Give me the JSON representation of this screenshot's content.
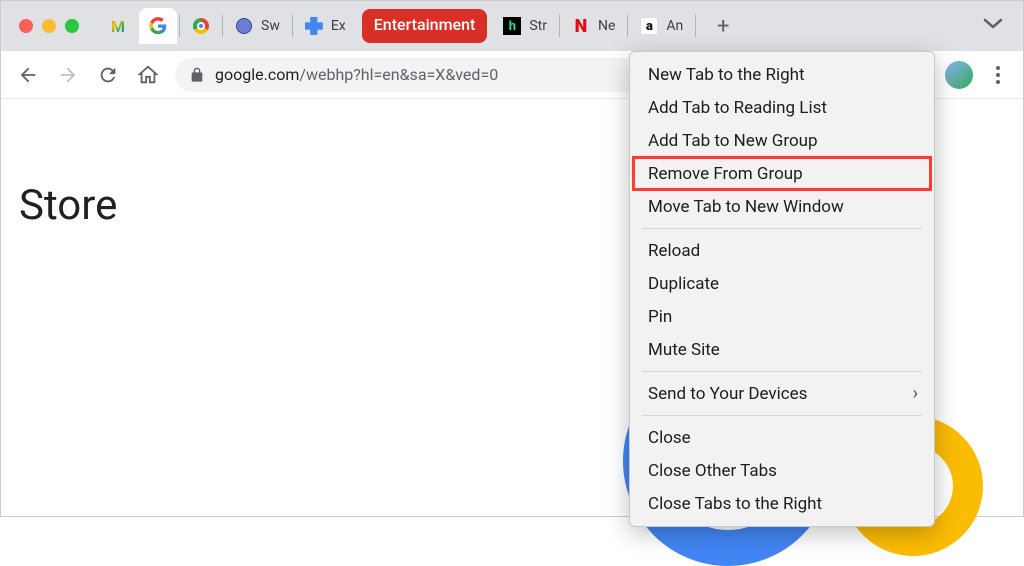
{
  "window_controls": [
    "close",
    "minimize",
    "maximize"
  ],
  "tabs": [
    {
      "favicon": "gmail",
      "label": ""
    },
    {
      "favicon": "google",
      "label": "",
      "active": true
    },
    {
      "favicon": "chrome",
      "label": ""
    },
    {
      "favicon": "globe",
      "label": "Sw"
    },
    {
      "favicon": "ext",
      "label": "Ex"
    }
  ],
  "tab_group": {
    "label": "Entertainment",
    "color": "#d93025"
  },
  "group_tabs": [
    {
      "favicon": "hulu",
      "label": "Str"
    },
    {
      "favicon": "netflix",
      "label": "Ne"
    },
    {
      "favicon": "amazon",
      "label": "An"
    }
  ],
  "url": {
    "host": "google.com",
    "path": "/webhp?hl=en&sa=X&ved=0"
  },
  "page": {
    "store_label": "Store"
  },
  "context_menu": {
    "groups": [
      [
        "New Tab to the Right",
        "Add Tab to Reading List",
        "Add Tab to New Group",
        "Remove From Group",
        "Move Tab to New Window"
      ],
      [
        "Reload",
        "Duplicate",
        "Pin",
        "Mute Site"
      ],
      [
        "Send to Your Devices"
      ],
      [
        "Close",
        "Close Other Tabs",
        "Close Tabs to the Right"
      ]
    ],
    "highlighted": "Remove From Group",
    "submenu": "Send to Your Devices"
  }
}
